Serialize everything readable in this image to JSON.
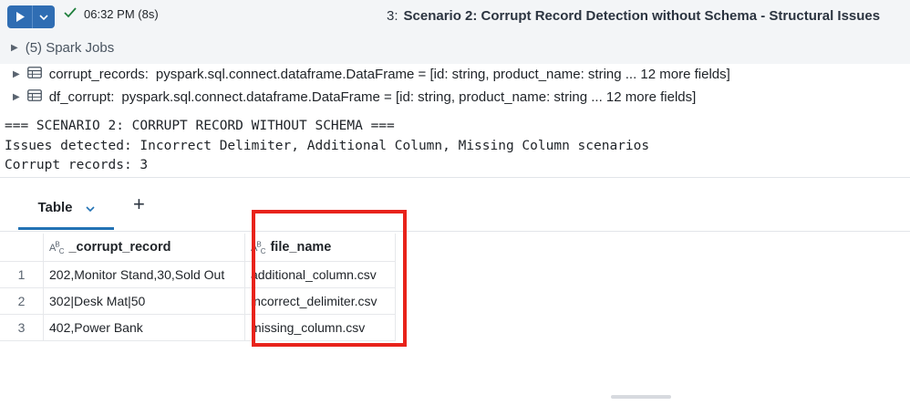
{
  "header": {
    "status_time": "06:32 PM (8s)",
    "cell_number": "3:",
    "cell_title": "Scenario 2: Corrupt Record Detection without Schema - Structural Issues",
    "run_color": "#2f6db3"
  },
  "jobs": {
    "label": "(5) Spark Jobs"
  },
  "dataframes": [
    {
      "name": "corrupt_records:",
      "type": "pyspark.sql.connect.dataframe.DataFrame = [id: string, product_name: string ... 12 more fields]"
    },
    {
      "name": "df_corrupt:",
      "type": "pyspark.sql.connect.dataframe.DataFrame = [id: string, product_name: string ... 12 more fields]"
    }
  ],
  "console": {
    "lines": [
      "=== SCENARIO 2: CORRUPT RECORD WITHOUT SCHEMA ===",
      "Issues detected: Incorrect Delimiter, Additional Column, Missing Column scenarios",
      "Corrupt records: 3"
    ]
  },
  "tabs": {
    "table_label": "Table",
    "add_label": "+"
  },
  "table": {
    "type_icon": "ABC",
    "columns": [
      "_corrupt_record",
      "file_name"
    ],
    "rows": [
      {
        "num": "1",
        "corrupt_record": "202,Monitor Stand,30,Sold Out",
        "file_name": "additional_column.csv"
      },
      {
        "num": "2",
        "corrupt_record": "302|Desk Mat|50",
        "file_name": "incorrect_delimiter.csv"
      },
      {
        "num": "3",
        "corrupt_record": "402,Power Bank",
        "file_name": "missing_column.csv"
      }
    ]
  },
  "annotation": {
    "highlight_color": "#e8231b"
  }
}
